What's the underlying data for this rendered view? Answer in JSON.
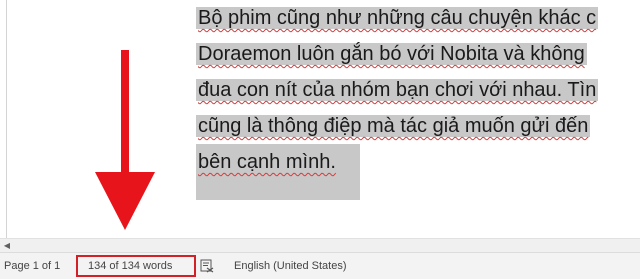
{
  "document": {
    "lines": [
      "Bộ phim cũng như những câu chuyện khác c",
      "Doraemon luôn gắn bó với Nobita và không",
      "đua con nít của nhóm bạn chơi với nhau. Tìn",
      "cũng là thông điệp mà tác giả muốn gửi đến",
      "bên cạnh mình."
    ]
  },
  "status_bar": {
    "page_info": "Page 1 of 1",
    "word_count": "134 of 134 words",
    "proofing_icon": "proofing-icon",
    "language": "English (United States)"
  },
  "scrollbar": {
    "left_arrow_icon": "scroll-left-icon"
  },
  "annotation": {
    "arrow_color": "#e8141b",
    "highlight_color": "#d32027"
  }
}
